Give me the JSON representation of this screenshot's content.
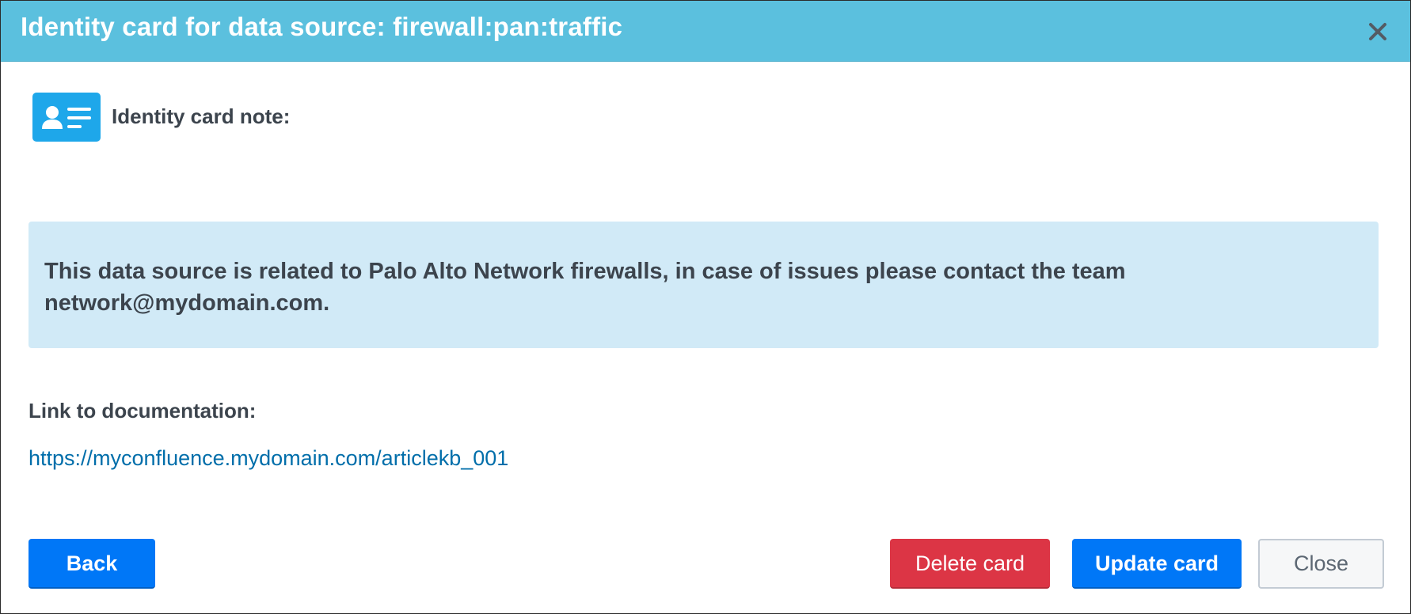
{
  "header": {
    "title": "Identity card for data source: firewall:pan:traffic",
    "close_icon": "close-icon",
    "background_color": "#5bc0de"
  },
  "note": {
    "icon": "identity-card-icon",
    "label": "Identity card note:",
    "text": "This data source is related to Palo Alto Network firewalls, in case of issues please contact the team network@mydomain.com.",
    "box_color": "#d1eaf7"
  },
  "documentation": {
    "label": "Link to documentation:",
    "link": "https://myconfluence.mydomain.com/articlekb_001",
    "link_color": "#006eaa"
  },
  "footer": {
    "back_label": "Back",
    "delete_label": "Delete card",
    "update_label": "Update card",
    "close_label": "Close",
    "primary_color": "#0077f7",
    "danger_color": "#dc3545"
  }
}
